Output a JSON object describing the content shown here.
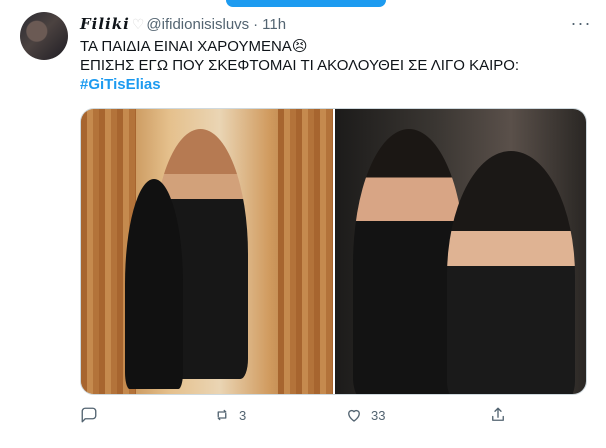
{
  "tweet": {
    "author_name": "Filiki",
    "author_handle": "@ifidionisisluvs",
    "time": "11h",
    "separator": "·",
    "text_line_1": "ΤΑ ΠΑΙΔΙΑ ΕΙΝΑΙ ΧΑΡΟΥΜΕΝΑ",
    "text_line_2": "ΕΠΙΣΗΣ ΕΓΩ ΠΟΥ ΣΚΕΦΤΟΜΑΙ ΤΙ ΑΚΟΛΟΥΘΕΙ ΣΕ ΛΙΓΟ ΚΑΙΡΟ:",
    "hashtag": "#GiTisElias",
    "emoji": "😣"
  },
  "actions": {
    "reply_count": "",
    "retweet_count": "3",
    "like_count": "33"
  },
  "colors": {
    "accent": "#1d9bf0",
    "muted": "#536471",
    "text": "#0f1419"
  },
  "icons": {
    "more": "more-dots-icon",
    "heart": "white-heart-icon",
    "reply": "reply-icon",
    "retweet": "retweet-icon",
    "like": "like-icon",
    "share": "share-icon"
  }
}
